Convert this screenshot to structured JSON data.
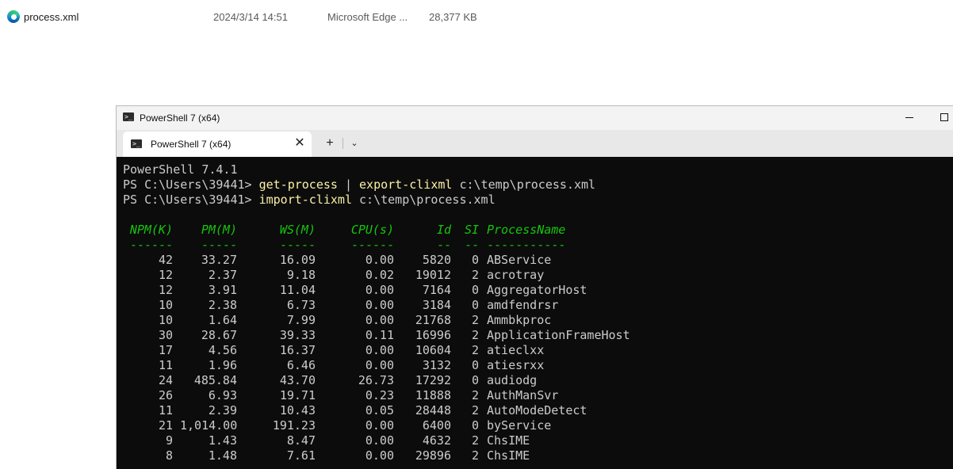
{
  "file": {
    "name": "process.xml",
    "date": "2024/3/14 14:51",
    "type": "Microsoft Edge ...",
    "size": "28,377 KB"
  },
  "window": {
    "title": "PowerShell 7 (x64)",
    "tab_label": "PowerShell 7 (x64)",
    "close_glyph": "✕",
    "plus_glyph": "+",
    "chevron_glyph": "⌄"
  },
  "console": {
    "version_line": "PowerShell 7.4.1",
    "prompt": "PS C:\\Users\\39441> ",
    "cmd1": "get-process",
    "pipe": " | ",
    "cmd2": "export-clixml",
    "arg2": " c:\\temp\\process.xml",
    "cmd3": "import-clixml",
    "arg3": " c:\\temp\\process.xml"
  },
  "table": {
    "headers": {
      "npm": "NPM(K)",
      "pm": "PM(M)",
      "ws": "WS(M)",
      "cpu": "CPU(s)",
      "id": "Id",
      "si": "SI",
      "name": "ProcessName"
    },
    "separators": {
      "npm": "------",
      "pm": "-----",
      "ws": "-----",
      "cpu": "------",
      "id": "--",
      "si": "--",
      "name": "-----------"
    },
    "rows": [
      {
        "npm": "42",
        "pm": "33.27",
        "ws": "16.09",
        "cpu": "0.00",
        "id": "5820",
        "si": "0",
        "name": "ABService"
      },
      {
        "npm": "12",
        "pm": "2.37",
        "ws": "9.18",
        "cpu": "0.02",
        "id": "19012",
        "si": "2",
        "name": "acrotray"
      },
      {
        "npm": "12",
        "pm": "3.91",
        "ws": "11.04",
        "cpu": "0.00",
        "id": "7164",
        "si": "0",
        "name": "AggregatorHost"
      },
      {
        "npm": "10",
        "pm": "2.38",
        "ws": "6.73",
        "cpu": "0.00",
        "id": "3184",
        "si": "0",
        "name": "amdfendrsr"
      },
      {
        "npm": "10",
        "pm": "1.64",
        "ws": "7.99",
        "cpu": "0.00",
        "id": "21768",
        "si": "2",
        "name": "Ammbkproc"
      },
      {
        "npm": "30",
        "pm": "28.67",
        "ws": "39.33",
        "cpu": "0.11",
        "id": "16996",
        "si": "2",
        "name": "ApplicationFrameHost"
      },
      {
        "npm": "17",
        "pm": "4.56",
        "ws": "16.37",
        "cpu": "0.00",
        "id": "10604",
        "si": "2",
        "name": "atieclxx"
      },
      {
        "npm": "11",
        "pm": "1.96",
        "ws": "6.46",
        "cpu": "0.00",
        "id": "3132",
        "si": "0",
        "name": "atiesrxx"
      },
      {
        "npm": "24",
        "pm": "485.84",
        "ws": "43.70",
        "cpu": "26.73",
        "id": "17292",
        "si": "0",
        "name": "audiodg"
      },
      {
        "npm": "26",
        "pm": "6.93",
        "ws": "19.71",
        "cpu": "0.23",
        "id": "11888",
        "si": "2",
        "name": "AuthManSvr"
      },
      {
        "npm": "11",
        "pm": "2.39",
        "ws": "10.43",
        "cpu": "0.05",
        "id": "28448",
        "si": "2",
        "name": "AutoModeDetect"
      },
      {
        "npm": "21",
        "pm": "1,014.00",
        "ws": "191.23",
        "cpu": "0.00",
        "id": "6400",
        "si": "0",
        "name": "byService"
      },
      {
        "npm": "9",
        "pm": "1.43",
        "ws": "8.47",
        "cpu": "0.00",
        "id": "4632",
        "si": "2",
        "name": "ChsIME"
      },
      {
        "npm": "8",
        "pm": "1.48",
        "ws": "7.61",
        "cpu": "0.00",
        "id": "29896",
        "si": "2",
        "name": "ChsIME"
      }
    ]
  }
}
